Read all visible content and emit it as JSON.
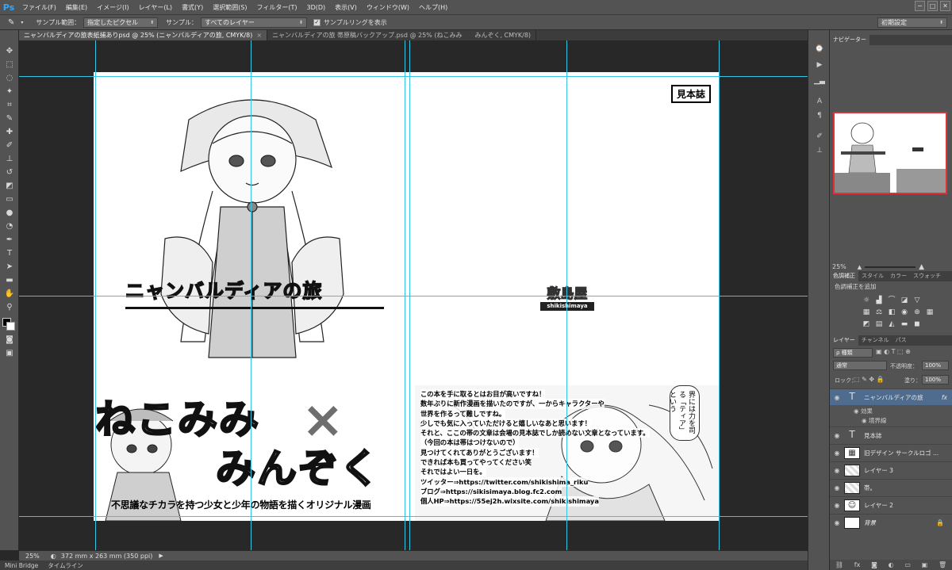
{
  "app": {
    "logo": "Ps"
  },
  "menu": [
    "ファイル(F)",
    "編集(E)",
    "イメージ(I)",
    "レイヤー(L)",
    "書式(Y)",
    "選択範囲(S)",
    "フィルター(T)",
    "3D(D)",
    "表示(V)",
    "ウィンドウ(W)",
    "ヘルプ(H)"
  ],
  "window_controls": {
    "minimize": "−",
    "maximize": "□",
    "close": "✕"
  },
  "options": {
    "sample_size_label": "サンプル範囲：",
    "sample_size_value": "指定したピクセル",
    "sample_label": "サンプル：",
    "sample_value": "すべてのレイヤー",
    "show_ring_label": "サンプルリングを表示",
    "workspace_value": "初期設定"
  },
  "tabs": [
    {
      "label": "ニャンバルディアの旅表紙捕ありpsd @ 25% (ニャンバルディアの旅, CMYK/8)",
      "active": true,
      "close": "×"
    },
    {
      "label": "ニャンバルディアの旅 帯原稿バックアップ.psd @ 25% (ねこみみ　　みんぞく, CMYK/8)",
      "active": false,
      "close": ""
    }
  ],
  "tools": [
    "move-icon",
    "marquee-icon",
    "lasso-icon",
    "magic-wand-icon",
    "crop-icon",
    "eyedropper-icon",
    "healing-icon",
    "brush-icon",
    "clone-stamp-icon",
    "history-brush-icon",
    "eraser-icon",
    "gradient-icon",
    "blur-icon",
    "dodge-icon",
    "pen-icon",
    "type-icon",
    "path-select-icon",
    "shape-icon",
    "hand-icon",
    "zoom-icon"
  ],
  "canvas": {
    "sample_badge": "見本誌",
    "book_title": "ニャンバルディアの旅",
    "circle_name": "敷島屋",
    "circle_roman": "shikishimaya",
    "series_line1": "ねこみみ",
    "series_cross": "×",
    "series_line2": "みんぞく",
    "tagline": "不思議なチカラを持つ少女と少年の物語を描くオリジナル漫画",
    "speech_bubble": "界には力を司る「ティア」という",
    "afterword": [
      "この本を手に取るとはお目が高いですね！",
      "数年ぶりに新作漫画を描いたのですが、一からキャラクターや",
      "世界を作るって難しですね。",
      "少しでも気に入っていただけると嬉しいなあと思います！",
      "それと、ここの帯の文章は会場の見本誌でしか読めない文章となっています。",
      "（今回の本は帯はつけないので）",
      "見つけてくれてありがとうございます！",
      "できれば本も買ってやってください笑",
      "それではよい一日を。",
      "ツイッター⇒https://twitter.com/shikishima_riku",
      "ブログ⇒https://sikisimaya.blog.fc2.com",
      "個人HP⇒https://55ej2h.wixsite.com/shikishimaya"
    ]
  },
  "status": {
    "zoom": "25%",
    "doc_size": "372 mm x 263 mm (350 ppi)",
    "arrow": "▶"
  },
  "bottom_tabs": [
    "Mini Bridge",
    "タイムライン"
  ],
  "navigator": {
    "tab": "ナビゲーター",
    "zoom": "25%"
  },
  "adjustments": {
    "tabs": [
      "色調補正",
      "スタイル",
      "カラー",
      "スウォッチ"
    ],
    "add_label": "色調補正を追加"
  },
  "layers_panel": {
    "tabs": [
      "レイヤー",
      "チャンネル",
      "パス"
    ],
    "filter_label": "ρ 種類",
    "blend_mode": "通常",
    "opacity_label": "不透明度：",
    "opacity_value": "100%",
    "lock_label": "ロック：",
    "fill_label": "塗り：",
    "fill_value": "100%",
    "fx": "fx",
    "effects_label": "効果",
    "stroke_label": "境界線",
    "layers": [
      {
        "name": "ニャンバルディアの旅",
        "kind": "type",
        "selected": true,
        "thumb": "T"
      },
      {
        "name": "見本誌",
        "kind": "type",
        "selected": false,
        "thumb": "T"
      },
      {
        "name": "旧デザイン サークルロゴ ...",
        "kind": "image",
        "selected": false,
        "thumb": "▦"
      },
      {
        "name": "レイヤー 3",
        "kind": "image",
        "selected": false,
        "thumb": ""
      },
      {
        "name": "帯。",
        "kind": "image",
        "selected": false,
        "thumb": ""
      },
      {
        "name": "レイヤー 2",
        "kind": "image",
        "selected": false,
        "thumb": "☺"
      },
      {
        "name": "背景",
        "kind": "background",
        "selected": false,
        "thumb": "",
        "lock": "🔒"
      }
    ]
  }
}
